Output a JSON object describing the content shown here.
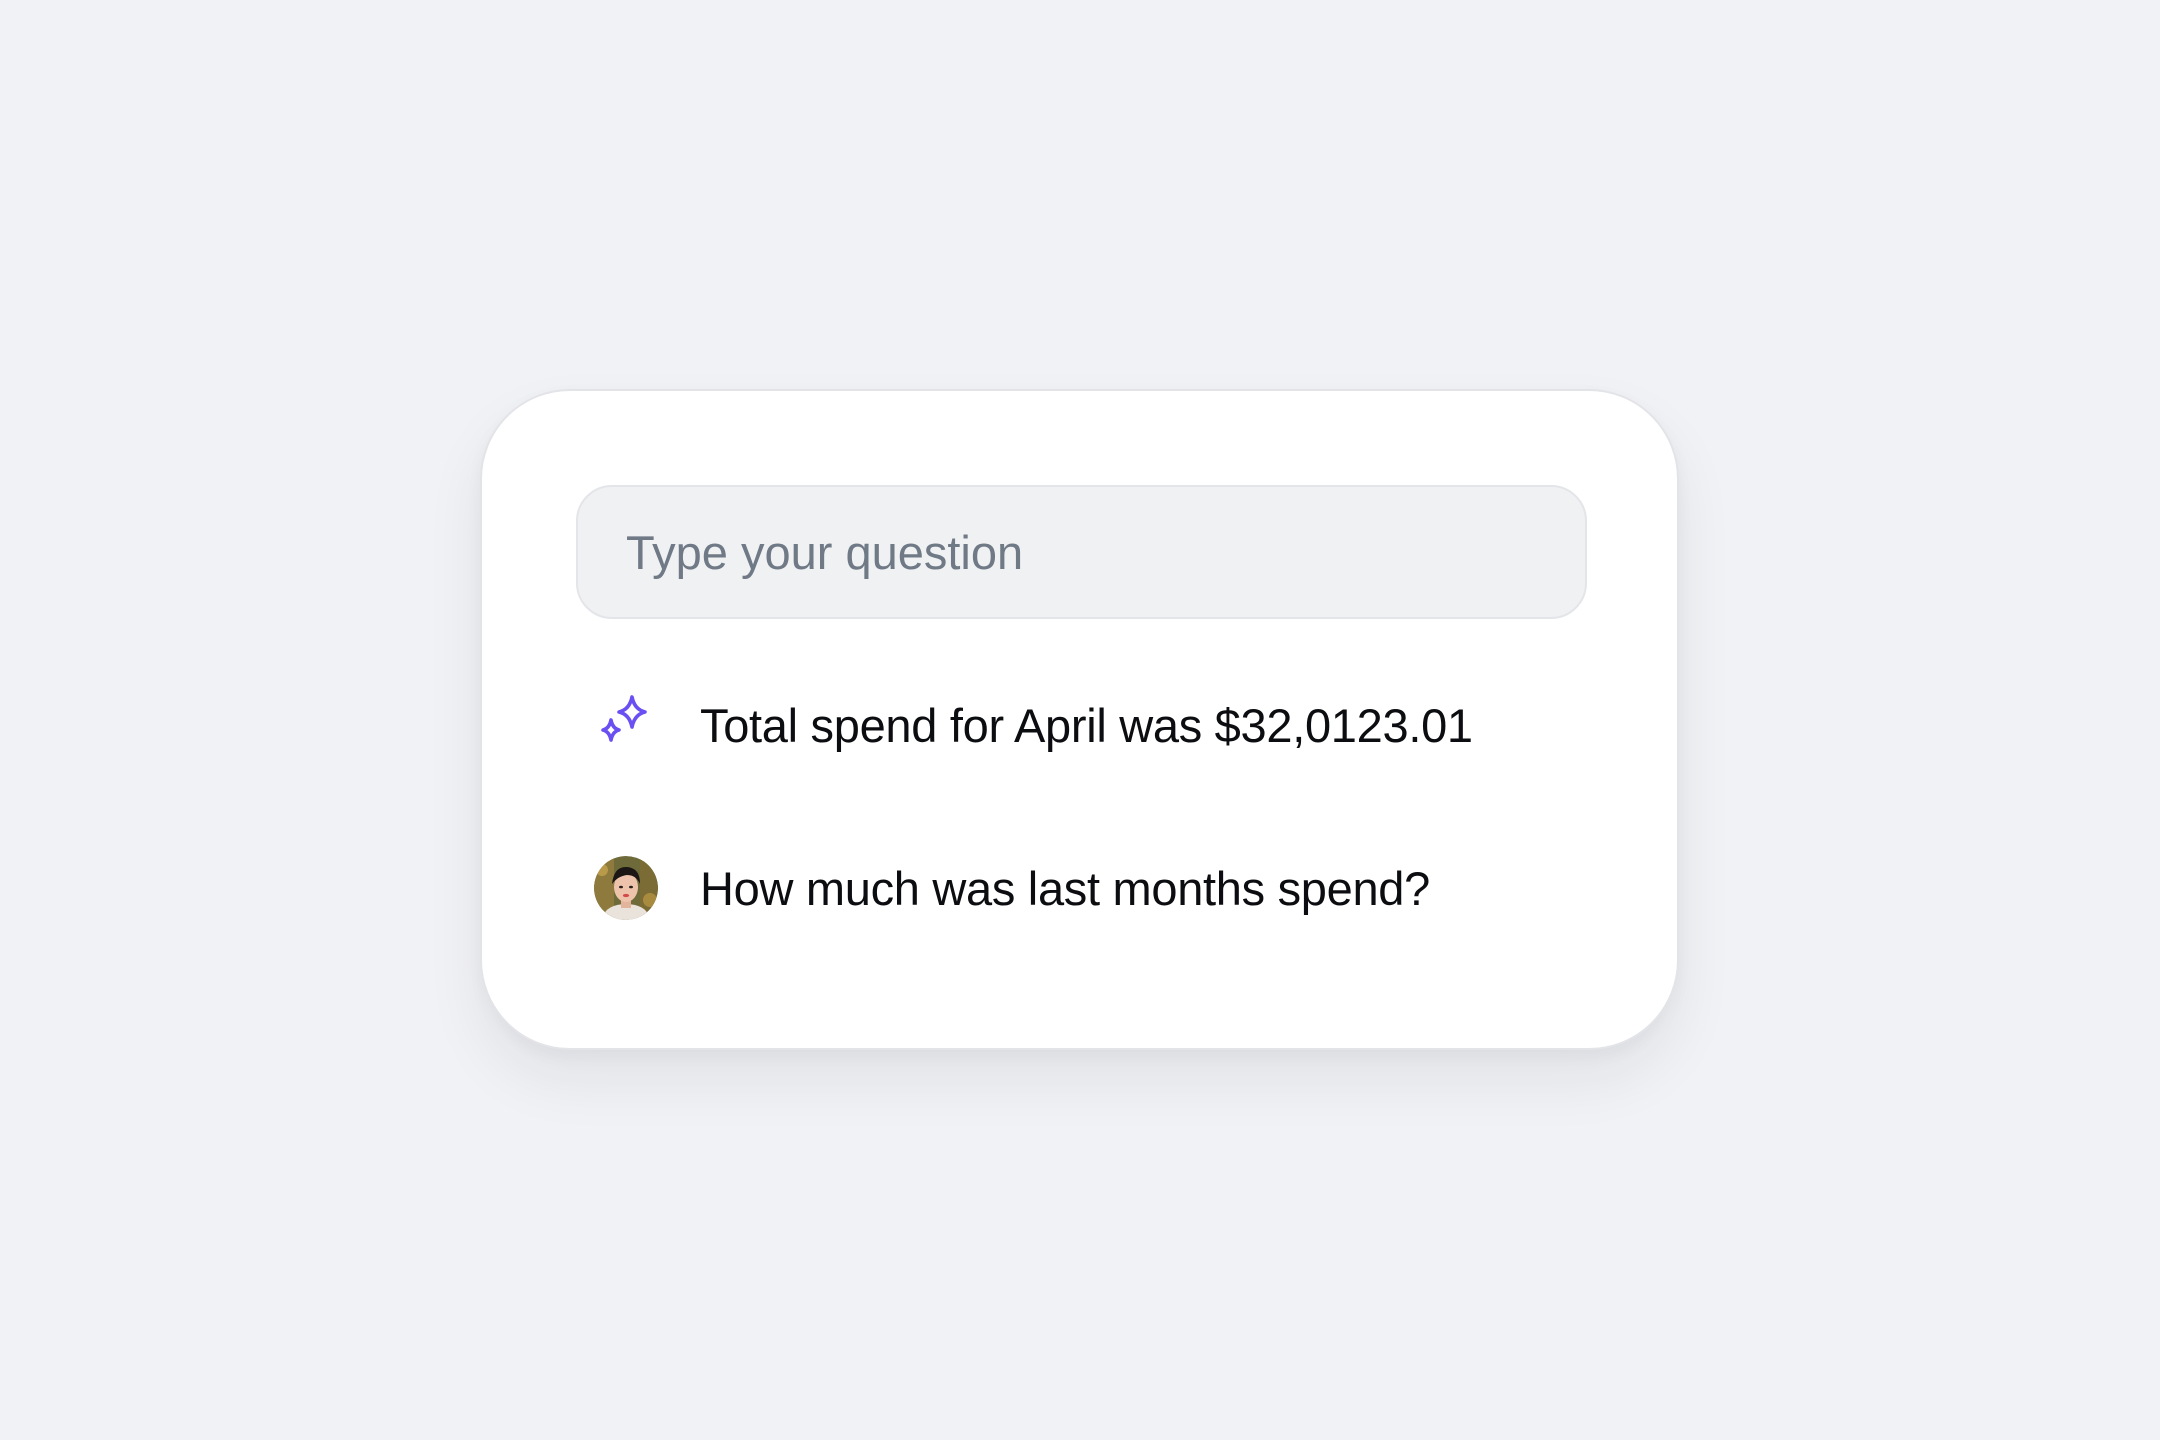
{
  "chat": {
    "input": {
      "placeholder": "Type your question",
      "value": ""
    },
    "messages": [
      {
        "role": "assistant",
        "icon": "sparkles-icon",
        "text": "Total spend for April was $32,0123.01"
      },
      {
        "role": "user",
        "icon": "user-avatar",
        "text": "How much was last months spend?"
      }
    ]
  },
  "colors": {
    "background": "#f1f2f5",
    "card": "#ffffff",
    "input_background": "#f0f1f3",
    "placeholder": "#6f7a86",
    "accent": "#6a4ff2",
    "text": "#0c0d10"
  }
}
